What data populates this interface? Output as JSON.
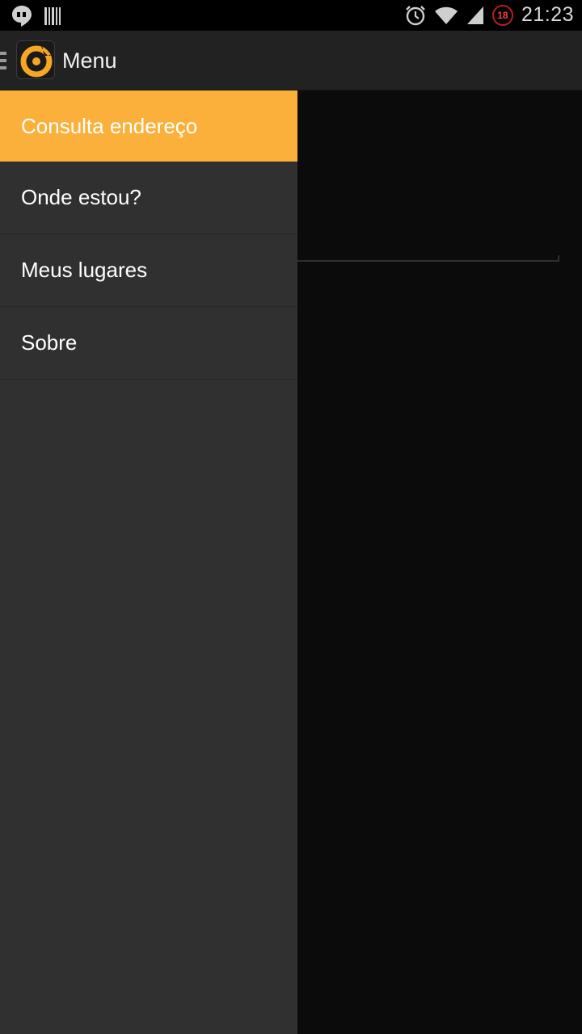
{
  "status_bar": {
    "time": "21:23",
    "notification_badge": "18",
    "icons": [
      "hangouts-icon",
      "barcode-icon",
      "alarm-icon",
      "wifi-icon",
      "signal-icon"
    ]
  },
  "action_bar": {
    "title": "Menu"
  },
  "drawer": {
    "items": [
      {
        "label": "Consulta endereço",
        "active": true
      },
      {
        "label": "Onde estou?",
        "active": false
      },
      {
        "label": "Meus lugares",
        "active": false
      },
      {
        "label": "Sobre",
        "active": false
      }
    ]
  },
  "colors": {
    "accent": "#fbb03b",
    "drawer_bg": "#303030",
    "action_bar_bg": "#222222",
    "content_bg": "#0b0b0b"
  }
}
